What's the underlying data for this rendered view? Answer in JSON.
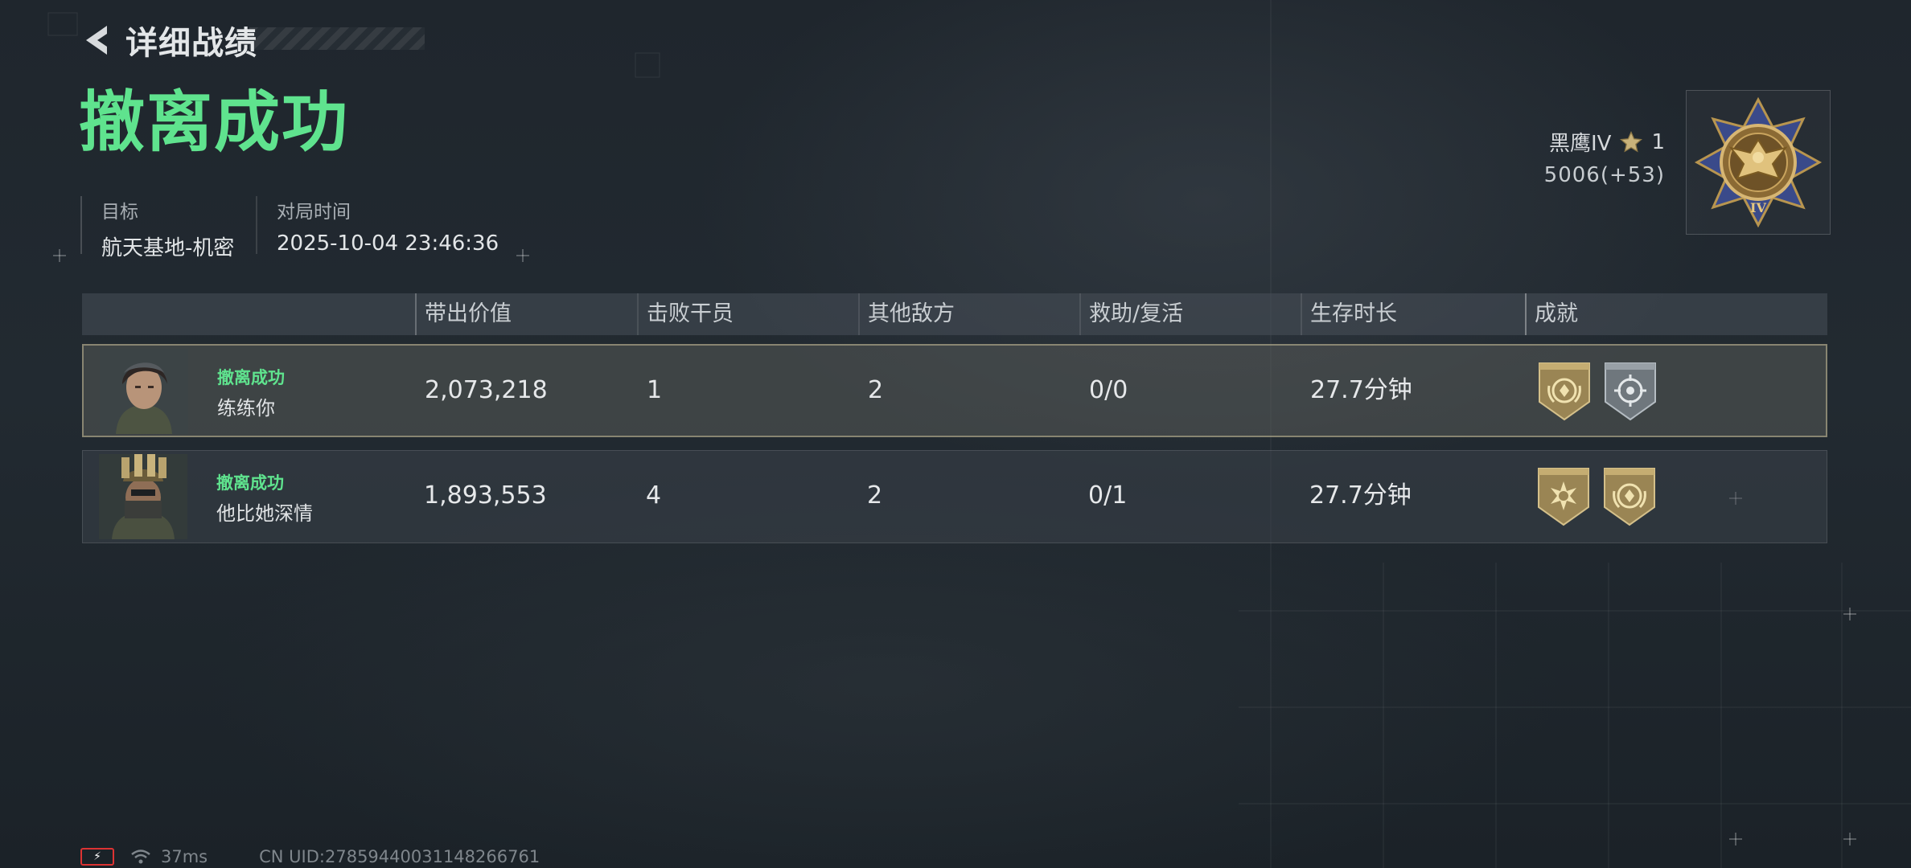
{
  "header": {
    "back_icon": "chevron-left-icon",
    "title": "详细战绩"
  },
  "result": {
    "title": "撤离成功",
    "color": "#5fe38e"
  },
  "info": {
    "target_label": "目标",
    "target_value": "航天基地-机密",
    "time_label": "对局时间",
    "time_value": "2025-10-04 23:46:36"
  },
  "rank": {
    "name": "黑鹰IV",
    "star_icon": "star-icon",
    "stars": "1",
    "score": "5006(+53)",
    "badge_icon": "eagle-medal-icon",
    "badge_numeral": "IV"
  },
  "table": {
    "headers": [
      "带出价值",
      "击败干员",
      "其他敌方",
      "救助/复活",
      "生存时长",
      "成就"
    ],
    "rows": [
      {
        "status": "撤离成功",
        "name": "练练你",
        "value": "2,073,218",
        "kills": "1",
        "others": "2",
        "assist": "0/0",
        "survival": "27.7分钟",
        "achievements": [
          "gold-laurel-badge-icon",
          "silver-crosshair-badge-icon"
        ]
      },
      {
        "status": "撤离成功",
        "name": "他比她深情",
        "value": "1,893,553",
        "kills": "4",
        "others": "2",
        "assist": "0/1",
        "survival": "27.7分钟",
        "achievements": [
          "gold-sunburst-badge-icon",
          "gold-laurel-badge-icon"
        ]
      }
    ]
  },
  "footer": {
    "battery_icon": "battery-charging-icon",
    "wifi_icon": "wifi-icon",
    "ping": "37ms",
    "uid": "CN UID:27859440031148266761"
  }
}
